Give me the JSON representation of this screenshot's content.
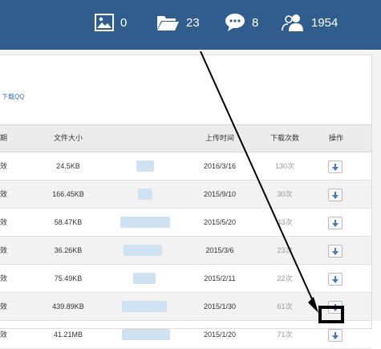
{
  "header": {
    "stats": [
      {
        "icon": "image-icon",
        "value": "0"
      },
      {
        "icon": "folder-icon",
        "value": "23"
      },
      {
        "icon": "chat-icon",
        "value": "8"
      },
      {
        "icon": "users-icon",
        "value": "1954"
      }
    ]
  },
  "links": {
    "download_qq": "下载QQ"
  },
  "table": {
    "headers": [
      "期",
      "文件大小",
      "",
      "上传时间",
      "下载次数",
      "操作"
    ],
    "rows": [
      {
        "status": "效",
        "size": "24.5KB",
        "time": "2016/3/16",
        "count": "130次"
      },
      {
        "status": "效",
        "size": "166.45KB",
        "time": "2015/9/10",
        "count": "30次"
      },
      {
        "status": "效",
        "size": "58.47KB",
        "time": "2015/5/20",
        "count": "43次"
      },
      {
        "status": "效",
        "size": "36.26KB",
        "time": "2015/3/6",
        "count": "23次"
      },
      {
        "status": "效",
        "size": "75.49KB",
        "time": "2015/2/11",
        "count": "22次"
      },
      {
        "status": "效",
        "size": "439.89KB",
        "time": "2015/1/30",
        "count": "61次"
      },
      {
        "status": "效",
        "size": "41.21MB",
        "time": "2015/1/20",
        "count": "71次"
      }
    ]
  },
  "colors": {
    "header_bg": "#305d8e",
    "link": "#3a6fb0",
    "blurred": "#cfe2f2"
  }
}
